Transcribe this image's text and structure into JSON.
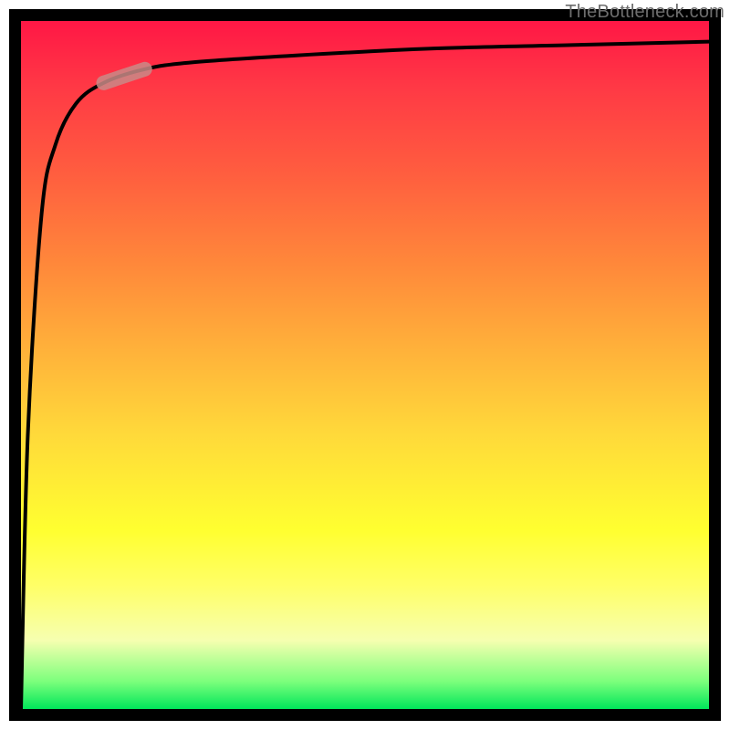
{
  "attribution": "TheBottleneck.com",
  "chart_data": {
    "type": "line",
    "title": "",
    "xlabel": "",
    "ylabel": "",
    "xlim": [
      0,
      100
    ],
    "ylim": [
      0,
      100
    ],
    "x": [
      0,
      1,
      3,
      5,
      8,
      12,
      18,
      25,
      40,
      60,
      80,
      100
    ],
    "values": [
      0,
      40,
      72,
      82,
      88,
      91,
      93,
      94,
      95,
      96,
      96.5,
      97
    ],
    "marker": {
      "x": 18,
      "y": 93,
      "x2": 12,
      "y2": 91
    },
    "colors": {
      "curve": "#000000",
      "marker_fill": "#c98a87"
    }
  }
}
